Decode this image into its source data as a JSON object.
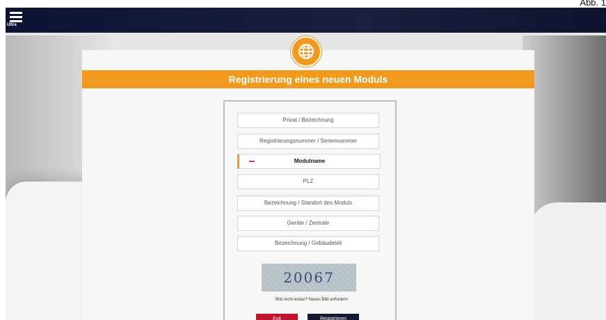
{
  "caption": "Abb. 1",
  "header": {
    "menu_label": "Ultra"
  },
  "registration": {
    "title": "Registrierung eines neuen Moduls",
    "fields": [
      {
        "label": "Privat / Bezeichnung"
      },
      {
        "label": "Registrierungsnummer / Seriennummer"
      },
      {
        "label": "Modulname",
        "error": true
      },
      {
        "label": "PLZ"
      },
      {
        "label": "Bezeichnung / Standort des Moduls"
      },
      {
        "label": "Geräte / Zentrale"
      },
      {
        "label": "Bezeichnung / Gebäudeteil"
      }
    ],
    "captcha_text": "20067",
    "captcha_refresh": "Bild nicht lesbar? Neues Bild anfordern",
    "buttons": {
      "cancel": "Exit",
      "submit": "Registrieren"
    }
  },
  "colors": {
    "accent": "#f29a1e",
    "topbar": "#0d1433",
    "danger": "#c4122a"
  },
  "icons": {
    "logo": "globe-icon",
    "menu": "hamburger-menu-icon"
  }
}
